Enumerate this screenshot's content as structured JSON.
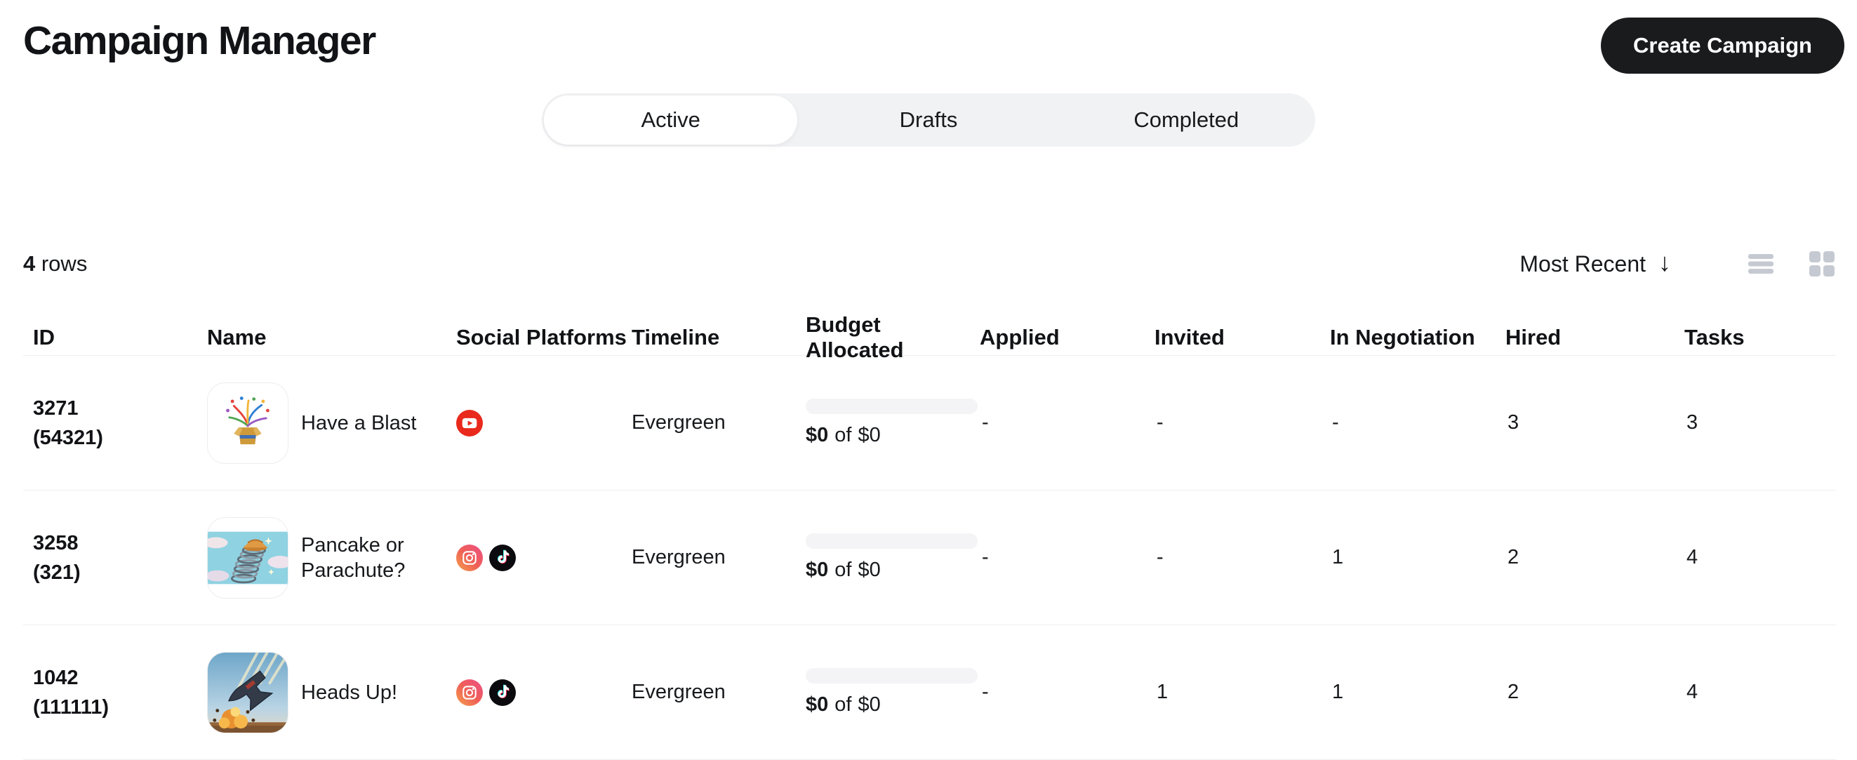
{
  "header": {
    "title": "Campaign Manager",
    "create_button_label": "Create Campaign"
  },
  "tabs": [
    {
      "label": "Active",
      "active": true
    },
    {
      "label": "Drafts",
      "active": false
    },
    {
      "label": "Completed",
      "active": false
    }
  ],
  "toolbar": {
    "row_count": "4",
    "row_count_suffix": " rows",
    "sort_label": "Most Recent",
    "sort_direction": "descending",
    "sort_arrow_glyph": "↓",
    "view_icons": [
      "list-view-icon",
      "grid-view-icon"
    ]
  },
  "table": {
    "columns": [
      "ID",
      "Name",
      "Social Platforms",
      "Timeline",
      "Budget Allocated",
      "Applied",
      "Invited",
      "In Negotiation",
      "Hired",
      "Tasks"
    ],
    "rows": [
      {
        "id": "3271",
        "sub_id": "(54321)",
        "name": "Have a Blast",
        "thumbnail": "confetti-box-illustration",
        "platforms": [
          "youtube"
        ],
        "timeline": "Evergreen",
        "budget_spent": "$0",
        "budget_separator": "of",
        "budget_total": "$0",
        "budget_progress_percent": 0,
        "applied": "-",
        "invited": "-",
        "in_negotiation": "-",
        "hired": "3",
        "tasks": "3"
      },
      {
        "id": "3258",
        "sub_id": "(321)",
        "name": "Pancake or Parachute?",
        "thumbnail": "slinky-pancake-illustration",
        "platforms": [
          "instagram",
          "tiktok"
        ],
        "timeline": "Evergreen",
        "budget_spent": "$0",
        "budget_separator": "of",
        "budget_total": "$0",
        "budget_progress_percent": 0,
        "applied": "-",
        "invited": "-",
        "in_negotiation": "1",
        "hired": "2",
        "tasks": "4"
      },
      {
        "id": "1042",
        "sub_id": "(111111)",
        "name": "Heads Up!",
        "thumbnail": "falling-anvil-illustration",
        "platforms": [
          "instagram",
          "tiktok"
        ],
        "timeline": "Evergreen",
        "budget_spent": "$0",
        "budget_separator": "of",
        "budget_total": "$0",
        "budget_progress_percent": 0,
        "applied": "-",
        "invited": "1",
        "in_negotiation": "1",
        "hired": "2",
        "tasks": "4"
      }
    ]
  },
  "colors": {
    "button_bg": "#1a1b1d",
    "tab_bar_bg": "#f1f2f4",
    "divider": "#eeeef0",
    "muted_icon": "#c5cad2",
    "progress_track": "#f4f4f6",
    "youtube_red": "#e8291c",
    "tiktok_black": "#0b0b0f",
    "instagram_gradient": [
      "#f5a14b",
      "#ef5e57",
      "#ec4f87"
    ]
  }
}
